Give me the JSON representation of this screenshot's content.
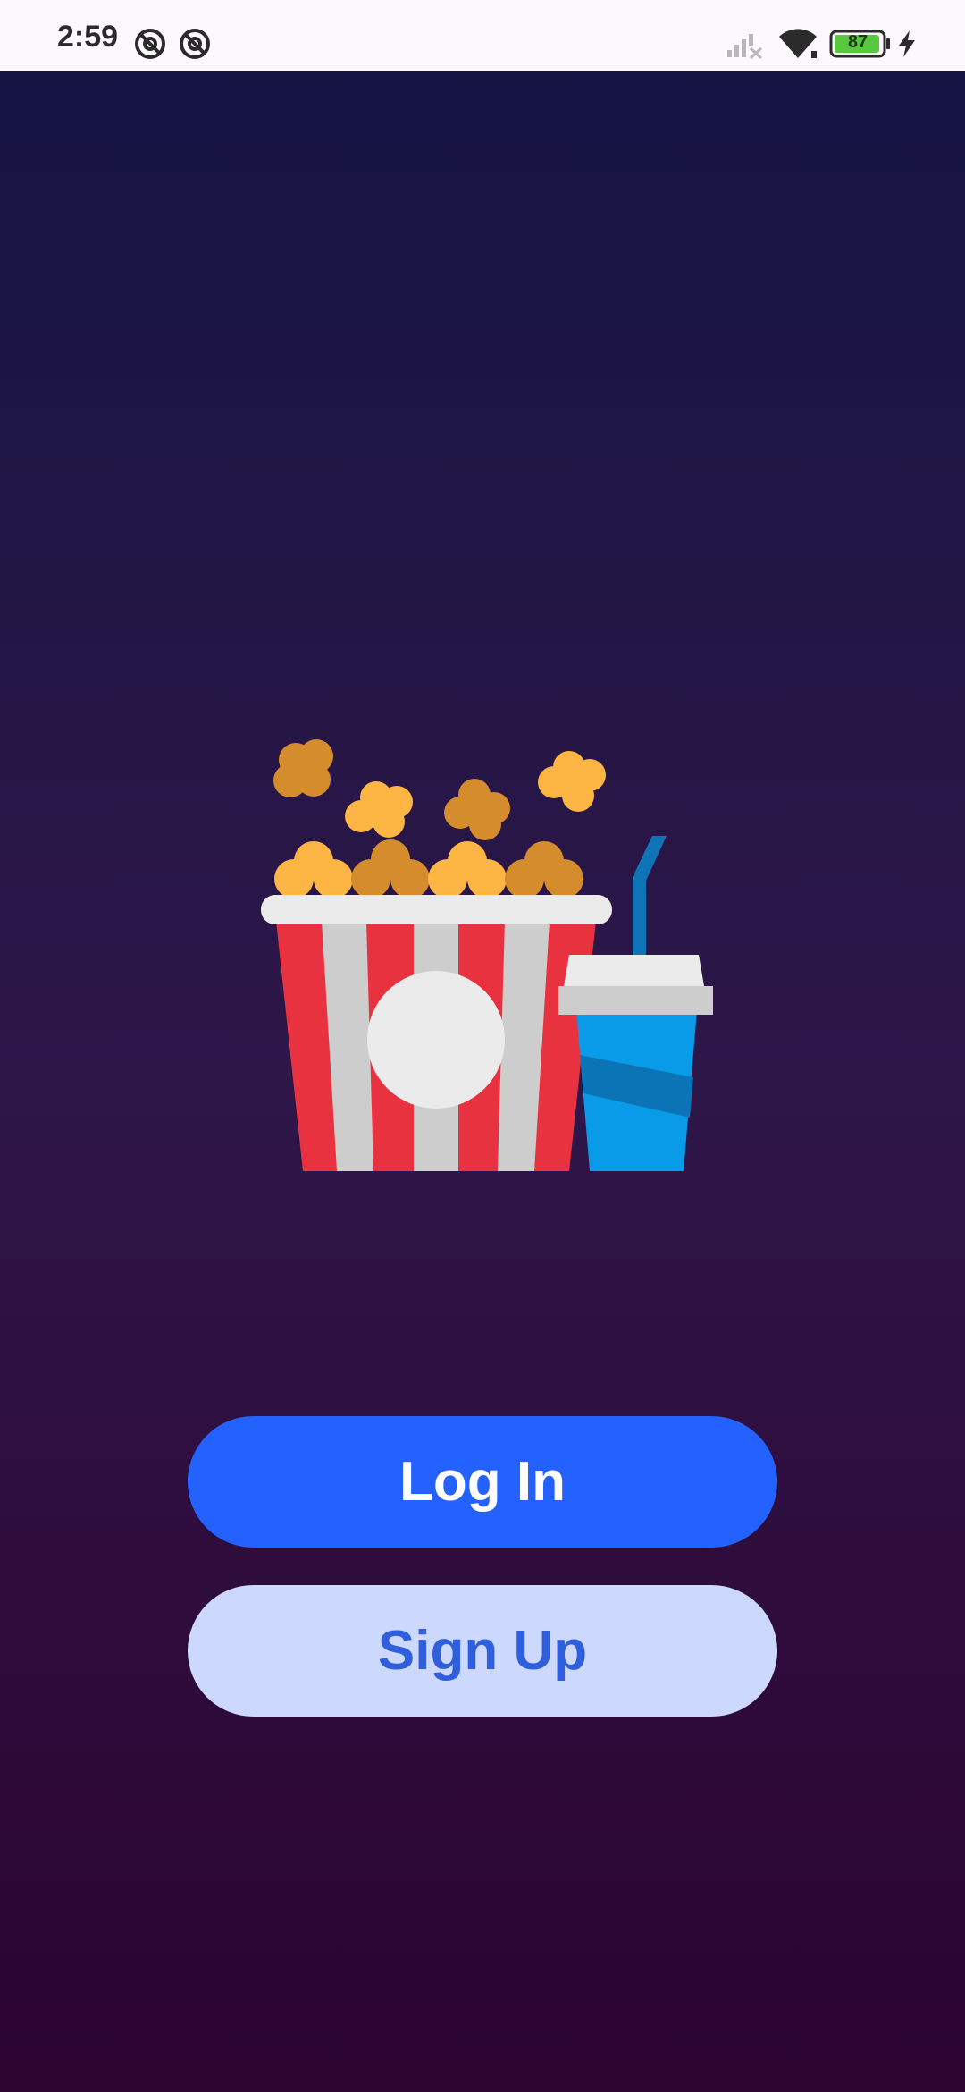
{
  "status_bar": {
    "time": "2:59",
    "battery_level": "87",
    "left_icons": [
      "do-not-disturb-icon",
      "do-not-disturb-icon"
    ],
    "right_icons": [
      "signal-off-icon",
      "wifi-icon",
      "battery-icon",
      "charging-icon"
    ],
    "battery_color": "#58c83e"
  },
  "illustration": {
    "subject": "popcorn-and-soda-icon"
  },
  "actions": {
    "login_label": "Log In",
    "signup_label": "Sign Up"
  },
  "colors": {
    "background_top": "#131443",
    "background_bottom": "#2b0430",
    "login_button": "#2462ff",
    "signup_button": "#cdd8ff",
    "signup_text": "#2f5fdc"
  }
}
